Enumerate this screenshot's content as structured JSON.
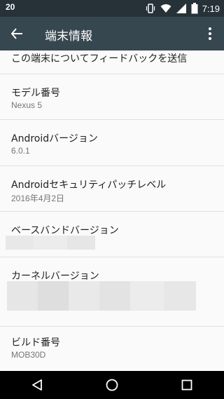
{
  "status_bar": {
    "notification_count": "20",
    "time": "7:19",
    "icons": [
      "vibrate-icon",
      "wifi-icon",
      "signal-icon",
      "battery-icon"
    ]
  },
  "app_bar": {
    "title": "端末情報",
    "back_icon": "arrow-back-icon",
    "menu_icon": "more-vert-icon"
  },
  "items": [
    {
      "title": "この端末についてフィードバックを送信",
      "subtitle": ""
    },
    {
      "title": "モデル番号",
      "subtitle": "Nexus 5"
    },
    {
      "title": "Androidバージョン",
      "subtitle": "6.0.1"
    },
    {
      "title": "Androidセキュリティパッチレベル",
      "subtitle": "2016年4月2日"
    },
    {
      "title": "ベースバンドバージョン",
      "subtitle": ""
    },
    {
      "title": "カーネルバージョン",
      "subtitle": ""
    },
    {
      "title": "ビルド番号",
      "subtitle": "MOB30D"
    }
  ],
  "nav_bar": {
    "icons": [
      "back-triangle-icon",
      "home-circle-icon",
      "recents-square-icon"
    ]
  },
  "colors": {
    "status_bar": "#263238",
    "app_bar": "#37474f",
    "background": "#fafafa",
    "divider": "#e0e0e0",
    "primary_text": "#212121",
    "secondary_text": "#757575"
  }
}
